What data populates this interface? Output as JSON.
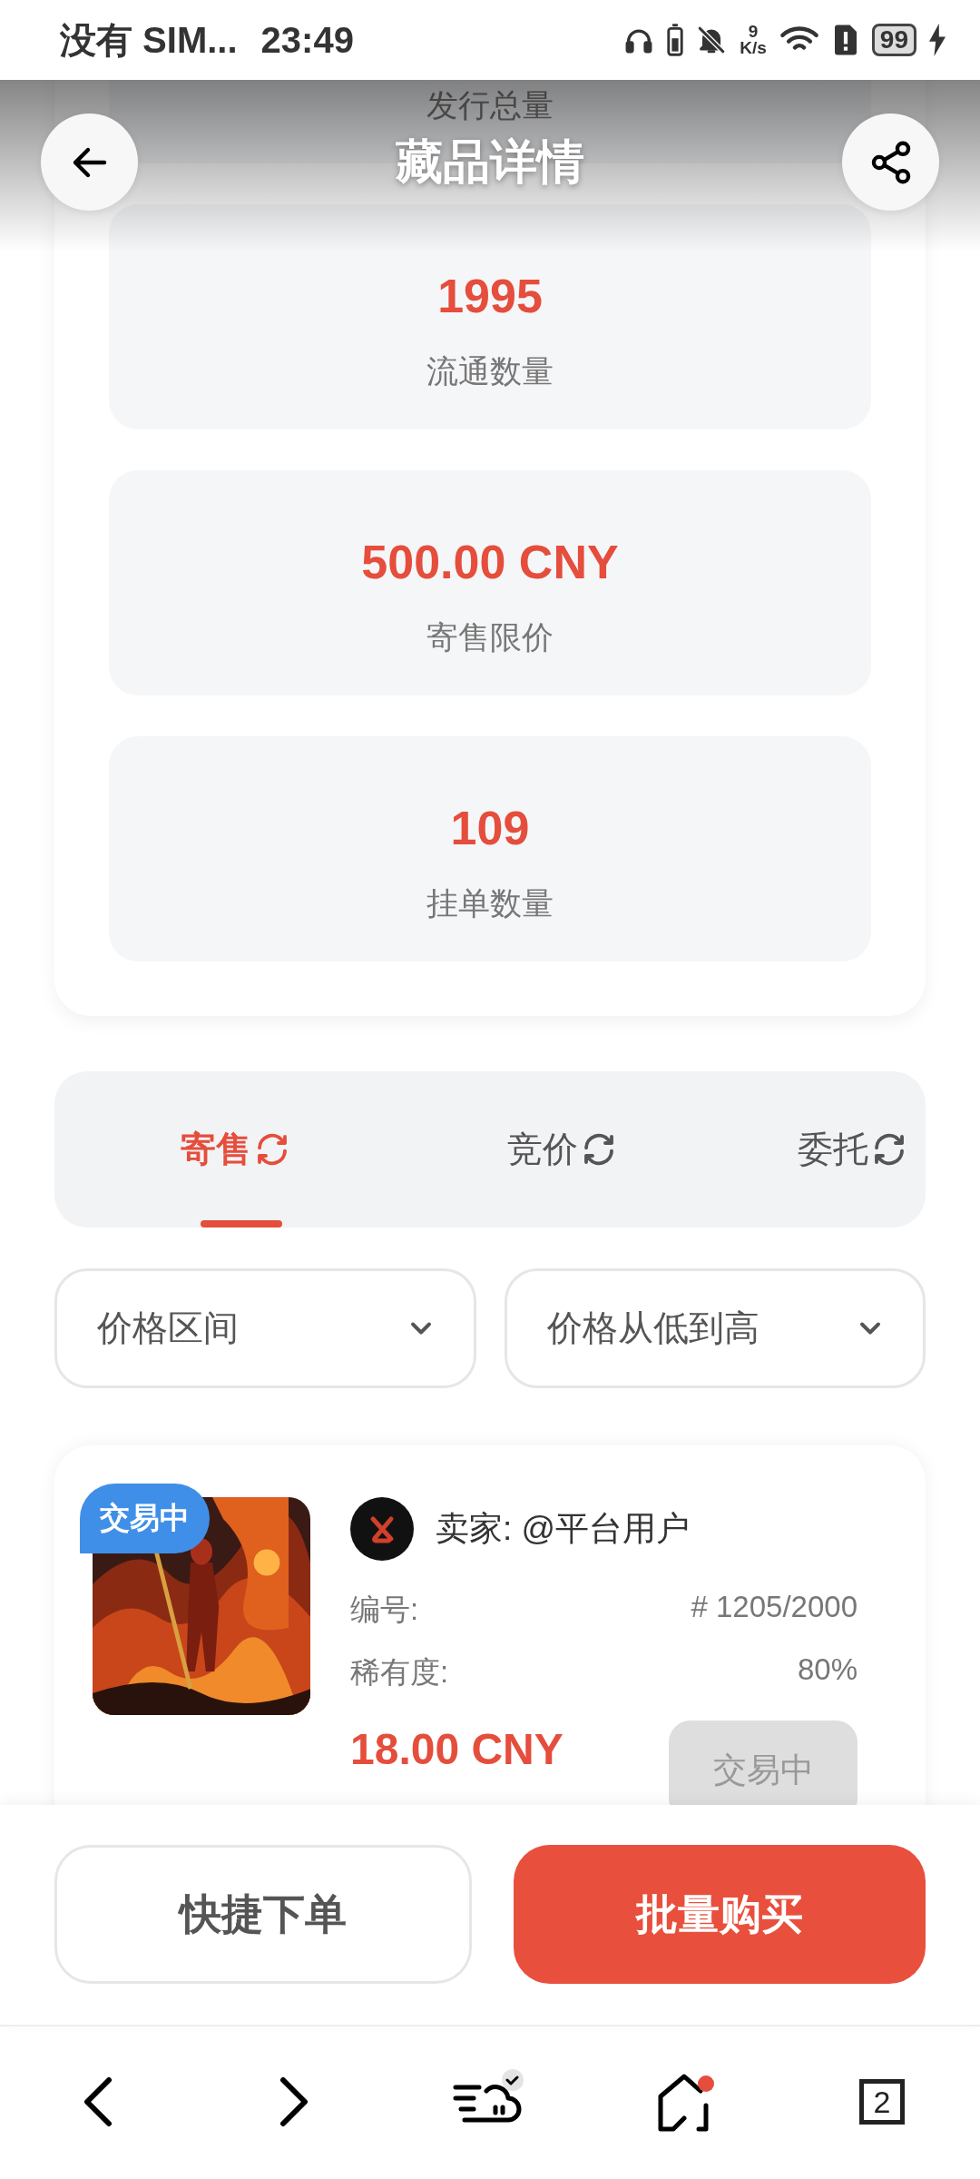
{
  "status_bar": {
    "carrier": "没有 SIM...",
    "time": "23:49",
    "net_speed_value": "9",
    "net_speed_unit": "K/s",
    "battery": "99"
  },
  "header": {
    "title": "藏品详情"
  },
  "stats": [
    {
      "label": "发行总量"
    },
    {
      "value": "1995",
      "label": "流通数量"
    },
    {
      "value": "500.00 CNY",
      "label": "寄售限价"
    },
    {
      "value": "109",
      "label": "挂单数量"
    }
  ],
  "tabs": [
    {
      "label": "寄售",
      "selected": true
    },
    {
      "label": "竞价",
      "selected": false
    },
    {
      "label": "委托",
      "selected": false
    }
  ],
  "filters": [
    {
      "label": "价格区间"
    },
    {
      "label": "价格从低到高"
    }
  ],
  "listings": [
    {
      "badge": "交易中",
      "seller": "卖家: @平台用户",
      "fields": [
        {
          "label": "编号:",
          "value": "# 1205/2000"
        },
        {
          "label": "稀有度:",
          "value": "80%"
        }
      ],
      "price": "18.00 CNY",
      "button": {
        "label": "交易中",
        "disabled": true
      }
    }
  ],
  "actions": [
    {
      "label": "快捷下单",
      "kind": "outline"
    },
    {
      "label": "批量购买",
      "kind": "primary"
    }
  ],
  "nav": {
    "tab_count": "2"
  }
}
